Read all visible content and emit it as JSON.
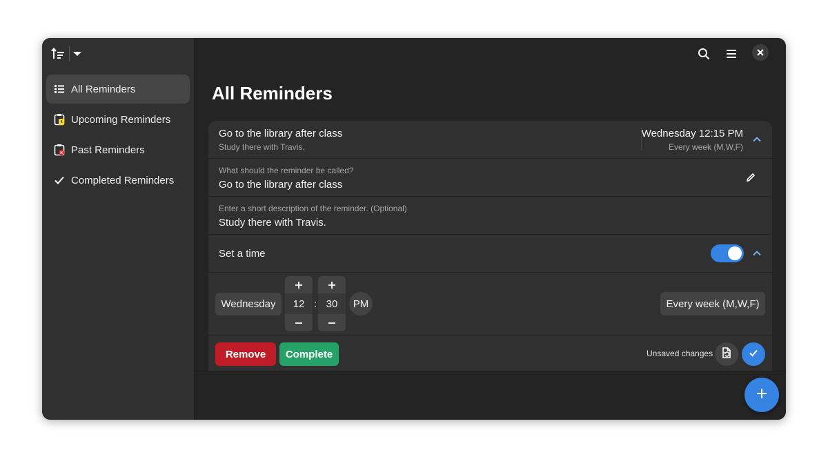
{
  "sidebar": {
    "items": [
      {
        "label": "All Reminders",
        "icon": "list-icon"
      },
      {
        "label": "Upcoming Reminders",
        "icon": "clipboard-clock-icon"
      },
      {
        "label": "Past Reminders",
        "icon": "clipboard-x-icon"
      },
      {
        "label": "Completed Reminders",
        "icon": "check-icon"
      }
    ],
    "active_item": "All Reminders"
  },
  "header": {
    "icons": [
      "sort-icon",
      "chevron-down-icon",
      "search-icon",
      "hamburger-menu-icon",
      "close-icon"
    ]
  },
  "main": {
    "title": "All Reminders",
    "reminder": {
      "title": "Go to the library after class",
      "description": "Study there with Travis.",
      "when": "Wednesday 12:15 PM",
      "repeat": "Every week (M,W,F)",
      "title_field": {
        "label": "What should the reminder be called?",
        "value": "Go to the library after class"
      },
      "description_field": {
        "label": "Enter a short description of the reminder. (Optional)",
        "value": "Study there with Travis."
      },
      "set_time": {
        "label": "Set a time",
        "enabled": true
      },
      "time": {
        "day": "Wednesday",
        "hour": "12",
        "separator": ":",
        "minute": "30",
        "period": "PM",
        "repeat": "Every week (M,W,F)"
      },
      "actions": {
        "remove_label": "Remove",
        "complete_label": "Complete",
        "status": "Unsaved changes"
      }
    }
  },
  "colors": {
    "accent": "#3584e4",
    "destructive": "#c01c28",
    "success": "#26a269",
    "window_bg": "#242424",
    "sidebar_bg": "#303030"
  }
}
